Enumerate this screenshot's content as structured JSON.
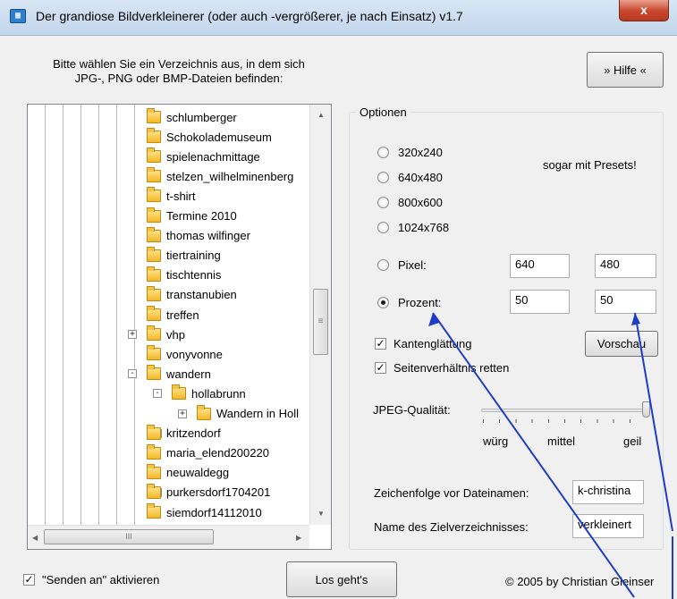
{
  "window": {
    "title": "Der grandiose Bildverkleinerer (oder auch -vergrößerer, je nach Einsatz) v1.7",
    "close_label": "x"
  },
  "instruction": {
    "line1": "Bitte wählen Sie ein Verzeichnis aus, in dem sich",
    "line2": "JPG-, PNG oder BMP-Dateien befinden:"
  },
  "help_button": "» Hilfe «",
  "tree": {
    "items": [
      {
        "label": "schlumberger",
        "expander": ""
      },
      {
        "label": "Schokolademuseum",
        "expander": ""
      },
      {
        "label": "spielenachmittage",
        "expander": ""
      },
      {
        "label": "stelzen_wilhelminenberg",
        "expander": ""
      },
      {
        "label": "t-shirt",
        "expander": ""
      },
      {
        "label": "Termine 2010",
        "expander": ""
      },
      {
        "label": "thomas wilfinger",
        "expander": ""
      },
      {
        "label": "tiertraining",
        "expander": ""
      },
      {
        "label": "tischtennis",
        "expander": ""
      },
      {
        "label": "transtanubien",
        "expander": ""
      },
      {
        "label": "treffen",
        "expander": ""
      },
      {
        "label": "vhp",
        "expander": "+"
      },
      {
        "label": "vonyvonne",
        "expander": ""
      },
      {
        "label": "wandern",
        "expander": "-"
      },
      {
        "label": "hollabrunn",
        "expander": "-"
      },
      {
        "label": "Wandern in Holl",
        "expander": "+"
      },
      {
        "label": "kritzendorf",
        "expander": "+"
      },
      {
        "label": "maria_elend200220",
        "expander": ""
      },
      {
        "label": "neuwaldegg",
        "expander": ""
      },
      {
        "label": "purkersdorf1704201",
        "expander": "+"
      },
      {
        "label": "siemdorf14112010",
        "expander": ""
      }
    ],
    "hscroll_grip": "III",
    "vscroll_grip": "≡"
  },
  "options": {
    "legend": "Optionen",
    "presets_note": "sogar mit Presets!",
    "presets": [
      "320x240",
      "640x480",
      "800x600",
      "1024x768"
    ],
    "pixel_label": "Pixel:",
    "pixel_width": "640",
    "pixel_height": "480",
    "percent_label": "Prozent:",
    "percent_width": "50",
    "percent_height": "50",
    "antialias_label": "Kantenglättung",
    "aspect_label": "Seitenverhältnis retten",
    "preview_button": "Vorschau",
    "jpeg_label": "JPEG-Qualität:",
    "jpeg_low": "würg",
    "jpeg_mid": "mittel",
    "jpeg_high": "geil",
    "jpeg_quality_level": 1.0,
    "prefix_label": "Zeichenfolge vor Dateinamen:",
    "prefix_value": "k-christina",
    "target_label": "Name des Zielverzeichnisses:",
    "target_value": "verkleinert"
  },
  "footer": {
    "send_to_label": "\"Senden an\" aktivieren",
    "go_button": "Los geht's",
    "copyright": "© 2005 by Christian Gleinser"
  },
  "colors": {
    "annotation_arrow": "#1f3cc8"
  }
}
